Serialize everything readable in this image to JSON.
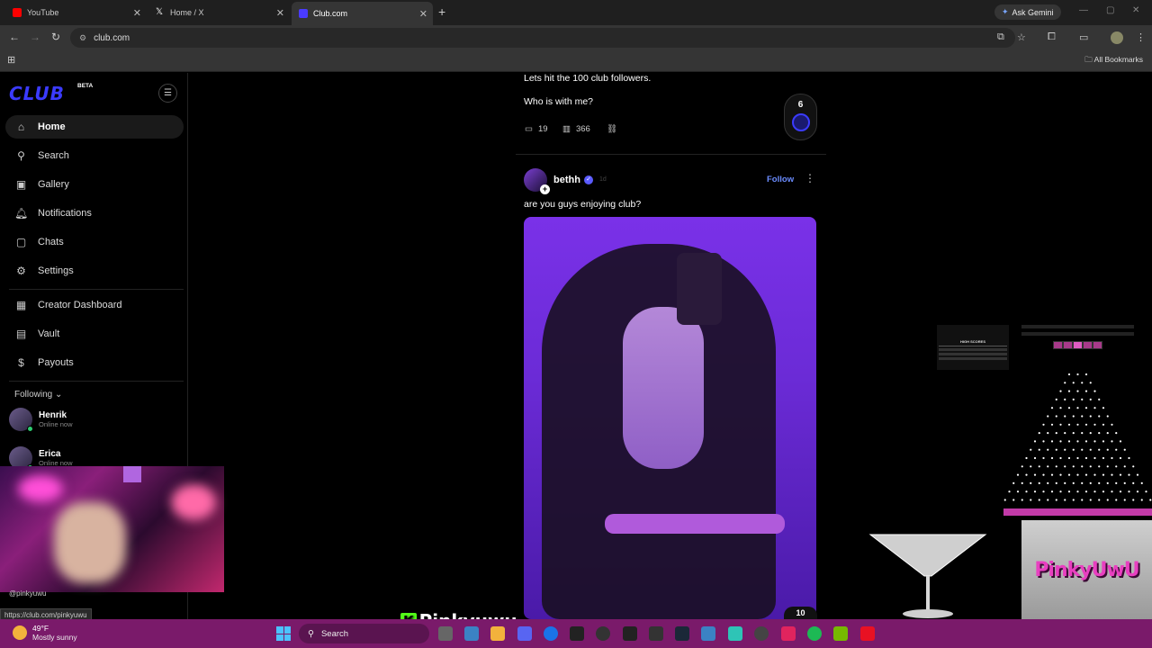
{
  "browser": {
    "tabs": [
      {
        "label": "YouTube",
        "active": false,
        "favicon_color": "#ff0000"
      },
      {
        "label": "Home / X",
        "active": false,
        "favicon_color": "#ffffff"
      },
      {
        "label": "Club.com",
        "active": true,
        "favicon_color": "#4a3bff"
      }
    ],
    "new_tab": "+",
    "ask_gemini": "Ask Gemini",
    "url": "club.com",
    "all_bookmarks": "All Bookmarks"
  },
  "sidebar": {
    "logo": "CLUB",
    "beta": "BETA",
    "nav": [
      {
        "label": "Home",
        "icon": "home-icon",
        "active": true
      },
      {
        "label": "Search",
        "icon": "search-icon",
        "active": false
      },
      {
        "label": "Gallery",
        "icon": "gallery-icon",
        "active": false
      },
      {
        "label": "Notifications",
        "icon": "bell-icon",
        "active": false
      },
      {
        "label": "Chats",
        "icon": "chat-icon",
        "active": false
      },
      {
        "label": "Settings",
        "icon": "gear-icon",
        "active": false
      }
    ],
    "nav2": [
      {
        "label": "Creator Dashboard",
        "icon": "dashboard-icon"
      },
      {
        "label": "Vault",
        "icon": "vault-icon"
      },
      {
        "label": "Payouts",
        "icon": "dollar-icon"
      }
    ],
    "following_label": "Following",
    "following": [
      {
        "name": "Henrik",
        "status": "Online now"
      },
      {
        "name": "Erica",
        "status": "Online now"
      }
    ],
    "profile_handle": "@pinkyuwu"
  },
  "status_url": "https://club.com/pinkyuwu",
  "feed": {
    "post1": {
      "line1": "Lets hit the 100 club followers.",
      "line2": "Who is with me?",
      "comments": "19",
      "views": "366",
      "badge": "6"
    },
    "post2": {
      "author": "bethh",
      "time": "1d",
      "follow": "Follow",
      "text": "are you guys enjoying club?",
      "badge": "10"
    }
  },
  "overlay": {
    "stream_name": "Pinkyuwu",
    "logo_text": "PinkyUwU",
    "hiscore_title": "HIGH SCORES"
  },
  "taskbar": {
    "temp": "49°F",
    "weather": "Mostly sunny",
    "search": "Search"
  }
}
